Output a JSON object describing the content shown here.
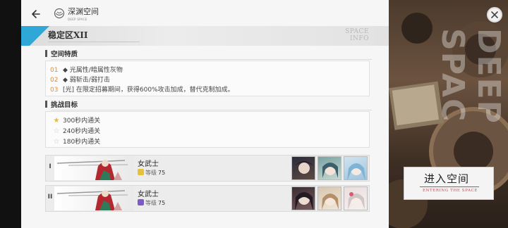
{
  "header": {
    "title": "深渊空间",
    "subtitle": "DEEP SPACE"
  },
  "zone": {
    "title": "稳定区XII",
    "space_info_line1": "SPACE",
    "space_info_line2": "INFO"
  },
  "traits": {
    "heading": "空间特质",
    "items": [
      {
        "num": "01",
        "text": "◆ 光属性/暗属性灰物"
      },
      {
        "num": "02",
        "text": "◆ 弱斩击/弱打击"
      },
      {
        "num": "03",
        "text": "[光] 在限定招募期间，获得600%攻击加成，替代克制加成。"
      }
    ]
  },
  "goals": {
    "heading": "挑战目标",
    "items": [
      {
        "text": "300秒内通关",
        "achieved": true
      },
      {
        "text": "240秒内通关",
        "achieved": false
      },
      {
        "text": "180秒内通关",
        "achieved": false
      }
    ]
  },
  "teams": [
    {
      "tag": "I",
      "name": "女武士",
      "level_label": "等级",
      "level": "75",
      "badge_color": "#e2c23a"
    },
    {
      "tag": "II",
      "name": "女武士",
      "level_label": "等级",
      "level": "75",
      "badge_color": "#7b5bc9"
    }
  ],
  "enter_button": {
    "label": "进入空间",
    "sub_label": "ENTERING THE SPACE"
  },
  "scene": {
    "watermark": "DEEP SPAC"
  },
  "colors": {
    "accent_blue": "#2fa8d8",
    "number_orange": "#e08a3b",
    "star_gold": "#e8b83a"
  }
}
